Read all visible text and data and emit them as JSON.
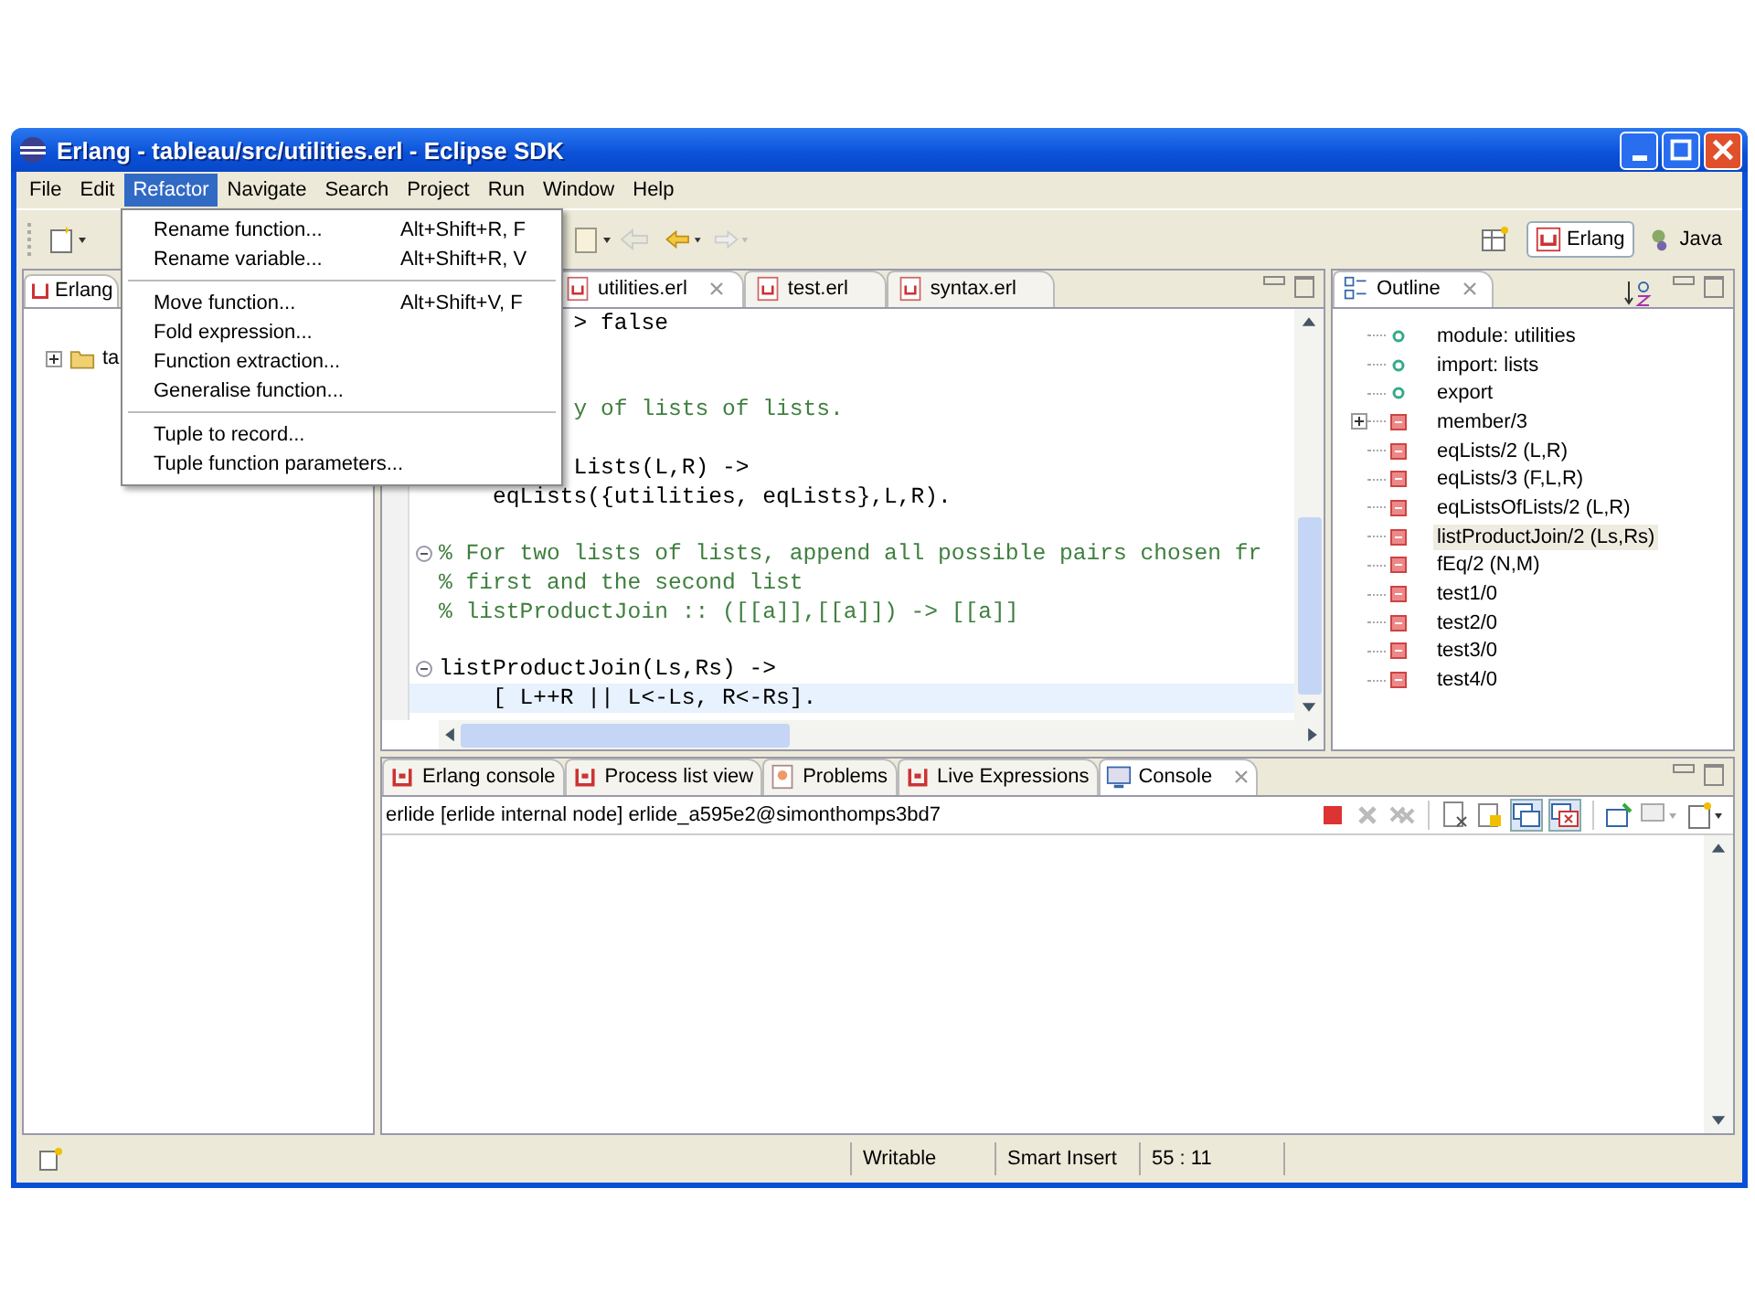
{
  "window": {
    "title": "Erlang - tableau/src/utilities.erl - Eclipse SDK"
  },
  "menu_bar": [
    {
      "label": "File",
      "selected": false
    },
    {
      "label": "Edit",
      "selected": false
    },
    {
      "label": "Refactor",
      "selected": true
    },
    {
      "label": "Navigate",
      "selected": false
    },
    {
      "label": "Search",
      "selected": false
    },
    {
      "label": "Project",
      "selected": false
    },
    {
      "label": "Run",
      "selected": false
    },
    {
      "label": "Window",
      "selected": false
    },
    {
      "label": "Help",
      "selected": false
    }
  ],
  "refactor_menu": [
    {
      "kind": "item",
      "label": "Rename function...",
      "shortcut": "Alt+Shift+R, F"
    },
    {
      "kind": "item",
      "label": "Rename variable...",
      "shortcut": "Alt+Shift+R, V"
    },
    {
      "kind": "separator"
    },
    {
      "kind": "item",
      "label": "Move function...",
      "shortcut": "Alt+Shift+V, F"
    },
    {
      "kind": "item",
      "label": "Fold expression..."
    },
    {
      "kind": "item",
      "label": "Function extraction..."
    },
    {
      "kind": "item",
      "label": "Generalise function..."
    },
    {
      "kind": "separator"
    },
    {
      "kind": "item",
      "label": "Tuple to record..."
    },
    {
      "kind": "item",
      "label": "Tuple function parameters..."
    }
  ],
  "perspectives": [
    {
      "label": "Erlang",
      "selected": true
    },
    {
      "label": "Java",
      "selected": false
    }
  ],
  "navigator": {
    "tab": "Erlang",
    "tree": [
      {
        "label": "ta",
        "expanded": false
      }
    ]
  },
  "editor": {
    "tabs": [
      {
        "label": "utilities.erl",
        "selected": true
      },
      {
        "label": "test.erl",
        "selected": false
      },
      {
        "label": "syntax.erl",
        "selected": false
      }
    ],
    "lines": [
      {
        "kind": "code",
        "text": "          > false",
        "fold": false,
        "current": false
      },
      {
        "kind": "blank",
        "fold": false,
        "current": false
      },
      {
        "kind": "blank",
        "fold": false,
        "current": false
      },
      {
        "kind": "comment",
        "text": "          y of lists of lists.",
        "fold": false,
        "current": false
      },
      {
        "kind": "blank",
        "fold": false,
        "current": false
      },
      {
        "kind": "code",
        "text": "          Lists(L,R) ->",
        "fold": false,
        "current": false
      },
      {
        "kind": "code",
        "text": "    eqLists({utilities, eqLists},L,R).",
        "fold": false,
        "current": false
      },
      {
        "kind": "blank",
        "fold": false,
        "current": false
      },
      {
        "kind": "comment",
        "text": "% For two lists of lists, append all possible pairs chosen fr",
        "fold": true,
        "current": false
      },
      {
        "kind": "comment",
        "text": "% first and the second list",
        "fold": false,
        "current": false
      },
      {
        "kind": "comment",
        "text": "% listProductJoin :: ([[a]],[[a]]) -> [[a]]",
        "fold": false,
        "current": false
      },
      {
        "kind": "blank",
        "fold": false,
        "current": false
      },
      {
        "kind": "code",
        "text": "listProductJoin(Ls,Rs) ->",
        "fold": true,
        "current": false
      },
      {
        "kind": "code",
        "text": "    [ L++R || L<-Ls, R<-Rs].",
        "fold": false,
        "current": true
      }
    ]
  },
  "outline": {
    "title": "Outline",
    "items": [
      {
        "kind": "attribute",
        "label": "module: utilities",
        "expandable": false,
        "selected": false
      },
      {
        "kind": "attribute",
        "label": "import: lists",
        "expandable": false,
        "selected": false
      },
      {
        "kind": "attribute",
        "label": "export",
        "expandable": false,
        "selected": false
      },
      {
        "kind": "function",
        "label": "member/3",
        "expandable": true,
        "selected": false
      },
      {
        "kind": "function",
        "label": "eqLists/2  (L,R)",
        "expandable": false,
        "selected": false
      },
      {
        "kind": "function",
        "label": "eqLists/3  (F,L,R)",
        "expandable": false,
        "selected": false
      },
      {
        "kind": "function",
        "label": "eqListsOfLists/2  (L,R)",
        "expandable": false,
        "selected": false
      },
      {
        "kind": "function",
        "label": "listProductJoin/2  (Ls,Rs)",
        "expandable": false,
        "selected": true
      },
      {
        "kind": "function",
        "label": "fEq/2  (N,M)",
        "expandable": false,
        "selected": false
      },
      {
        "kind": "function",
        "label": "test1/0",
        "expandable": false,
        "selected": false
      },
      {
        "kind": "function",
        "label": "test2/0",
        "expandable": false,
        "selected": false
      },
      {
        "kind": "function",
        "label": "test3/0",
        "expandable": false,
        "selected": false
      },
      {
        "kind": "function",
        "label": "test4/0",
        "expandable": false,
        "selected": false
      }
    ]
  },
  "console": {
    "tabs": [
      {
        "label": "Erlang console",
        "selected": false
      },
      {
        "label": "Process list view",
        "selected": false
      },
      {
        "label": "Problems",
        "selected": false
      },
      {
        "label": "Live Expressions",
        "selected": false
      },
      {
        "label": "Console",
        "selected": true
      }
    ],
    "header": "erlide [erlide internal node] erlide_a595e2@simonthomps3bd7"
  },
  "status_bar": {
    "mode": "Writable",
    "insert": "Smart Insert",
    "position": "55 : 11"
  }
}
